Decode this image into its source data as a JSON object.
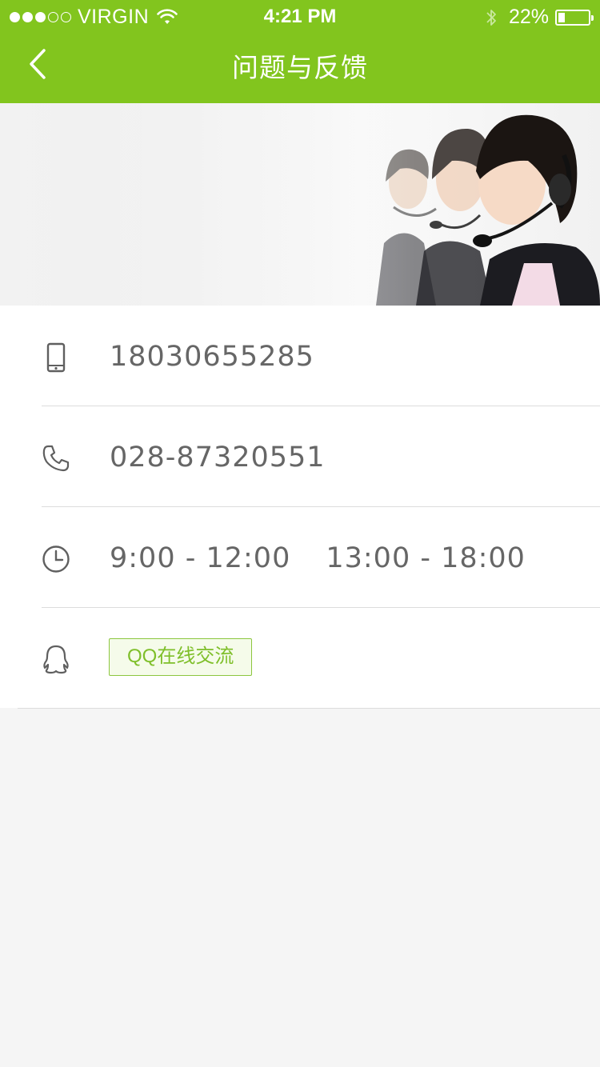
{
  "status_bar": {
    "carrier": "VIRGIN",
    "signal_bars_filled": 3,
    "signal_bars_total": 5,
    "time": "4:21 PM",
    "battery": "22%",
    "battery_level": 0.22
  },
  "nav": {
    "title": "问题与反馈",
    "back_icon": "chevron-left-icon"
  },
  "contacts": {
    "mobile": {
      "icon": "mobile-phone-icon",
      "value": "18030655285"
    },
    "landline": {
      "icon": "telephone-icon",
      "value": "028-87320551"
    },
    "hours": {
      "icon": "clock-icon",
      "morning": "9:00 - 12:00",
      "afternoon": "13:00 - 18:00"
    },
    "qq": {
      "icon": "qq-penguin-icon",
      "button_label": "QQ在线交流"
    }
  },
  "colors": {
    "accent": "#82c51e",
    "text_secondary": "#666666",
    "background": "#f5f5f5"
  }
}
